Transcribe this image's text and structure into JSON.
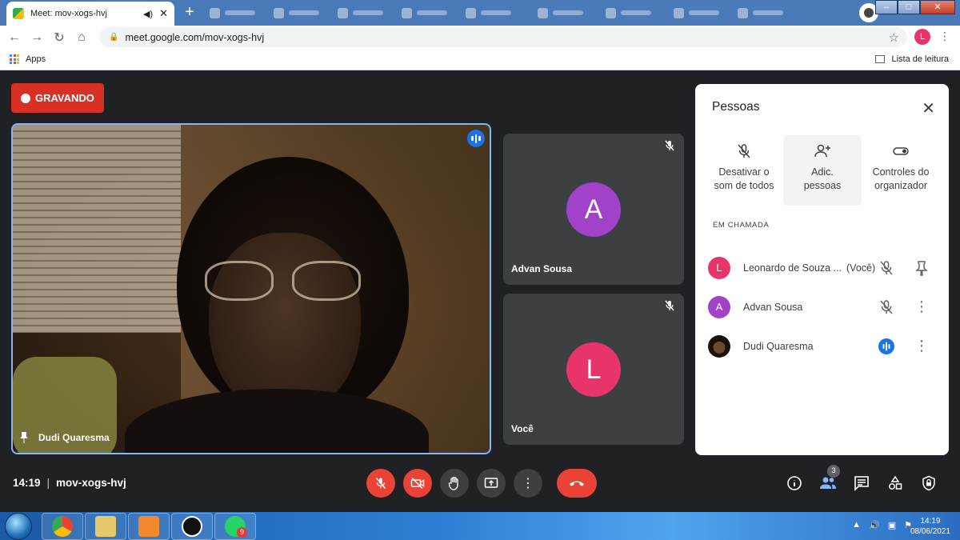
{
  "browser": {
    "active_tab_title": "Meet: mov-xogs-hvj",
    "new_tab_glyph": "+",
    "url": "meet.google.com/mov-xogs-hvj",
    "profile_initial": "L",
    "bookmark_apps": "Apps",
    "reading_list": "Lista de leitura"
  },
  "meet": {
    "recording_label": "GRAVANDO",
    "main_tile_name": "Dudi Quaresma",
    "tiles": [
      {
        "initial": "A",
        "name": "Advan Sousa",
        "color": "#a142c9"
      },
      {
        "initial": "L",
        "name": "Você",
        "color": "#e8336b"
      }
    ],
    "time": "14:19",
    "meeting_code": "mov-xogs-hvj",
    "participants_badge": "3"
  },
  "people_panel": {
    "title": "Pessoas",
    "actions": [
      {
        "line1": "Desativar o",
        "line2": "som de todos"
      },
      {
        "line1": "Adic.",
        "line2": "pessoas"
      },
      {
        "line1": "Controles do",
        "line2": "organizador"
      }
    ],
    "section_label": "EM CHAMADA",
    "participants": [
      {
        "initial": "L",
        "name": "Leonardo de Souza ...",
        "suffix": "(Você)",
        "color": "#e8336b"
      },
      {
        "initial": "A",
        "name": "Advan Sousa",
        "suffix": "",
        "color": "#a142c9"
      },
      {
        "initial": "",
        "name": "Dudi Quaresma",
        "suffix": "",
        "color": ""
      }
    ]
  },
  "taskbar": {
    "clock_time": "14:19",
    "clock_date": "08/06/2021",
    "whatsapp_badge": "9"
  },
  "colors": {
    "meet_bg": "#202124",
    "tile_bg": "#3c4043",
    "danger": "#ea4335",
    "accent": "#1a73e8"
  }
}
